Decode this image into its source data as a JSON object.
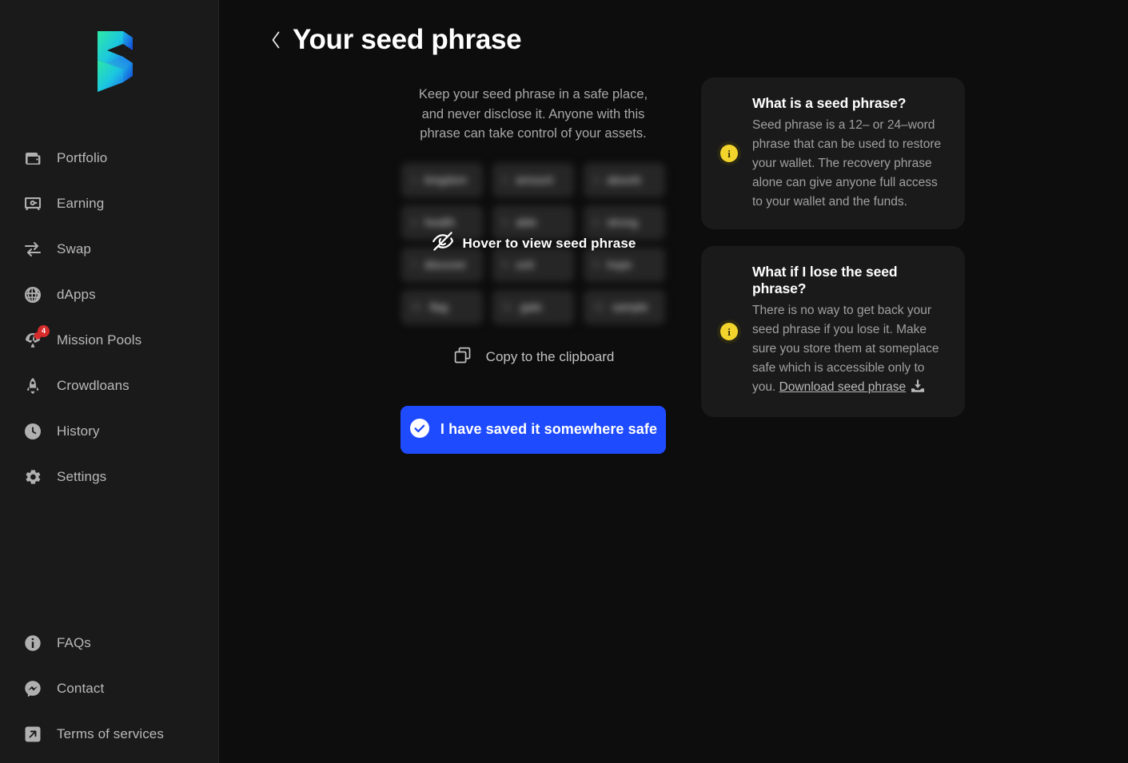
{
  "app": {
    "logo_name": "subwallet-logo"
  },
  "sidebar": {
    "main_items": [
      {
        "label": "Portfolio",
        "icon": "wallet-icon",
        "name": "sidebar-item-portfolio"
      },
      {
        "label": "Earning",
        "icon": "safe-box-icon",
        "name": "sidebar-item-earning"
      },
      {
        "label": "Swap",
        "icon": "swap-arrows-icon",
        "name": "sidebar-item-swap"
      },
      {
        "label": "dApps",
        "icon": "globe-icon",
        "name": "sidebar-item-dapps"
      },
      {
        "label": "Mission Pools",
        "icon": "parachute-icon",
        "name": "sidebar-item-mission-pools",
        "badge": "4"
      },
      {
        "label": "Crowdloans",
        "icon": "rocket-icon",
        "name": "sidebar-item-crowdloans"
      },
      {
        "label": "History",
        "icon": "clock-icon",
        "name": "sidebar-item-history"
      },
      {
        "label": "Settings",
        "icon": "gear-icon",
        "name": "sidebar-item-settings"
      }
    ],
    "bottom_items": [
      {
        "label": "FAQs",
        "icon": "info-circle-icon",
        "name": "sidebar-item-faqs"
      },
      {
        "label": "Contact",
        "icon": "messenger-icon",
        "name": "sidebar-item-contact"
      },
      {
        "label": "Terms of services",
        "icon": "external-link-icon",
        "name": "sidebar-item-terms"
      }
    ]
  },
  "header": {
    "title": "Your seed phrase",
    "back_icon": "chevron-left-icon"
  },
  "seed": {
    "description": "Keep your seed phrase in a safe place, and never disclose it. Anyone with this phrase can take control of your assets.",
    "hover_label": "Hover to view seed phrase",
    "hover_icon": "eye-off-icon",
    "copy_label": "Copy to the clipboard",
    "copy_icon": "copy-icon",
    "save_button_label": "I have saved it somewhere safe",
    "save_button_icon": "check-circle-icon",
    "save_button_color": "#1f4bff",
    "words": [
      {
        "num": "1.",
        "word": "kingdom"
      },
      {
        "num": "2.",
        "word": "amount"
      },
      {
        "num": "3.",
        "word": "absorb"
      },
      {
        "num": "4.",
        "word": "health"
      },
      {
        "num": "5.",
        "word": "able"
      },
      {
        "num": "6.",
        "word": "strong"
      },
      {
        "num": "7.",
        "word": "discover"
      },
      {
        "num": "8.",
        "word": "unit"
      },
      {
        "num": "9.",
        "word": "hope"
      },
      {
        "num": "10.",
        "word": "flag"
      },
      {
        "num": "11.",
        "word": "gate"
      },
      {
        "num": "12.",
        "word": "sample"
      }
    ]
  },
  "info_cards": [
    {
      "name": "info-card-what-is-seed-phrase",
      "icon": "info-icon",
      "icon_color": "#f2d42c",
      "title": "What is a seed phrase?",
      "text": "Seed phrase is a 12– or 24–word phrase that can be used to restore your wallet. The recovery phrase alone can give anyone full access to your wallet and the funds."
    },
    {
      "name": "info-card-lose-seed-phrase",
      "icon": "info-icon",
      "icon_color": "#f2d42c",
      "title": "What if I lose the seed phrase?",
      "text": "There is no way to get back your seed phrase if you lose it. Make sure you store them at someplace safe which is accessible only to you. ",
      "link_label": "Download seed phrase",
      "link_icon": "download-icon"
    }
  ]
}
